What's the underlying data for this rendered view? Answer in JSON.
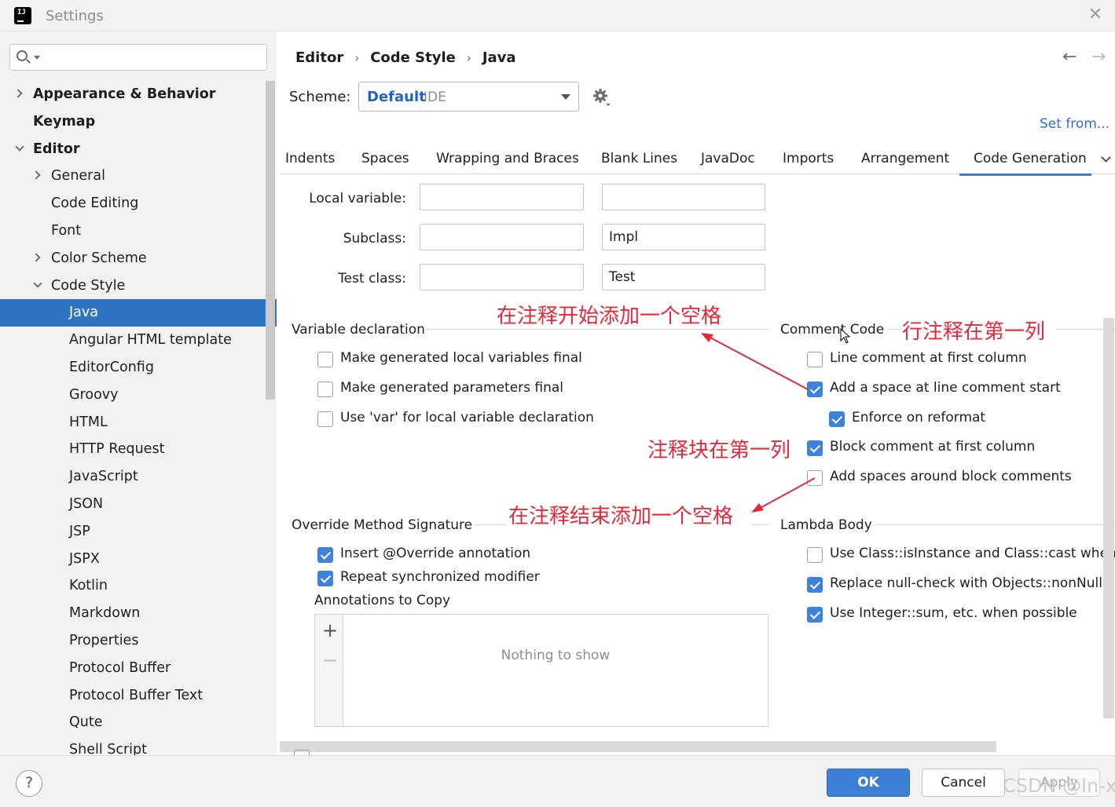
{
  "window": {
    "title": "Settings"
  },
  "search": {
    "placeholder": "",
    "value": ""
  },
  "sidebar": {
    "items": [
      {
        "label": "Appearance & Behavior"
      },
      {
        "label": "Keymap"
      },
      {
        "label": "Editor"
      },
      {
        "label": "General"
      },
      {
        "label": "Code Editing"
      },
      {
        "label": "Font"
      },
      {
        "label": "Color Scheme"
      },
      {
        "label": "Code Style"
      },
      {
        "label": "Java"
      },
      {
        "label": "Angular HTML template"
      },
      {
        "label": "EditorConfig"
      },
      {
        "label": "Groovy"
      },
      {
        "label": "HTML"
      },
      {
        "label": "HTTP Request"
      },
      {
        "label": "JavaScript"
      },
      {
        "label": "JSON"
      },
      {
        "label": "JSP"
      },
      {
        "label": "JSPX"
      },
      {
        "label": "Kotlin"
      },
      {
        "label": "Markdown"
      },
      {
        "label": "Properties"
      },
      {
        "label": "Protocol Buffer"
      },
      {
        "label": "Protocol Buffer Text"
      },
      {
        "label": "Qute"
      },
      {
        "label": "Shell Script"
      }
    ]
  },
  "breadcrumb": {
    "items": [
      "Editor",
      "Code Style",
      "Java"
    ]
  },
  "nav": {
    "back": "←",
    "forward": "→"
  },
  "scheme": {
    "label": "Scheme:",
    "value": "Default",
    "suffix": "IDE",
    "set_from": "Set from..."
  },
  "tabs": [
    "Indents",
    "Spaces",
    "Wrapping and Braces",
    "Blank Lines",
    "JavaDoc",
    "Imports",
    "Arrangement",
    "Code Generation"
  ],
  "naming": {
    "rows": [
      {
        "label": "Local variable:",
        "prefix": "",
        "suffix": ""
      },
      {
        "label": "Subclass:",
        "prefix": "",
        "suffix": "Impl"
      },
      {
        "label": "Test class:",
        "prefix": "",
        "suffix": "Test"
      }
    ]
  },
  "variable_declaration": {
    "title": "Variable declaration",
    "options": [
      {
        "label": "Make generated local variables final",
        "checked": false
      },
      {
        "label": "Make generated parameters final",
        "checked": false
      },
      {
        "label": "Use 'var' for local variable declaration",
        "checked": false
      }
    ]
  },
  "comment_code": {
    "title": "Comment Code",
    "options": [
      {
        "label": "Line comment at first column",
        "checked": false
      },
      {
        "label": "Add a space at line comment start",
        "checked": true
      },
      {
        "label": "Enforce on reformat",
        "checked": true
      },
      {
        "label": "Block comment at first column",
        "checked": true
      },
      {
        "label": "Add spaces around block comments",
        "checked": false
      }
    ]
  },
  "override": {
    "title": "Override Method Signature",
    "options": [
      {
        "label": "Insert @Override annotation",
        "checked": true
      },
      {
        "label": "Repeat synchronized modifier",
        "checked": true
      }
    ],
    "annotations_label": "Annotations to Copy",
    "add_icon": "+",
    "remove_icon": "−",
    "empty_text": "Nothing to show"
  },
  "lambda_body": {
    "title": "Lambda Body",
    "options": [
      {
        "label": "Use Class::isInstance and Class::cast when pos",
        "checked": false
      },
      {
        "label": "Replace null-check with Objects::nonNull or (",
        "checked": true
      },
      {
        "label": "Use Integer::sum, etc. when possible",
        "checked": true
      }
    ]
  },
  "annotations_red": {
    "start_space": "在注释开始添加一个空格",
    "line_first_col": "行注释在第一列",
    "block_first_col": "注释块在第一列",
    "end_space": "在注释结束添加一个空格"
  },
  "footer": {
    "help": "?",
    "ok": "OK",
    "cancel": "Cancel",
    "apply": "Apply",
    "watermark": "CSDN @In-x"
  },
  "colors": {
    "accent": "#3e82dc",
    "selection": "#2f73c4",
    "annotation_red": "#e8283a",
    "link": "#2f6fcf"
  }
}
